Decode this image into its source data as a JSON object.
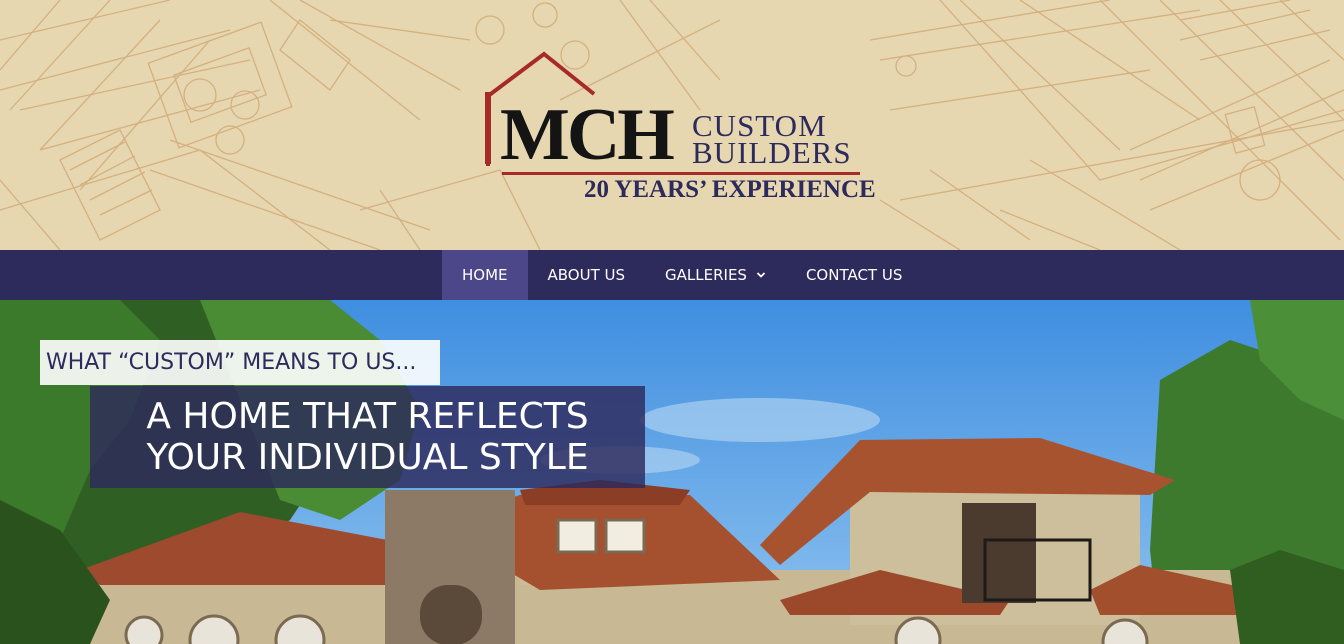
{
  "header": {
    "logo": {
      "mark": "MCH",
      "line1": "CUSTOM",
      "line2": "BUILDERS",
      "tagline": "20 YEARS’ EXPERIENCE"
    }
  },
  "nav": {
    "items": [
      {
        "label": "HOME",
        "active": true
      },
      {
        "label": "ABOUT US",
        "active": false
      },
      {
        "label": "GALLERIES",
        "active": false,
        "has_dropdown": true
      },
      {
        "label": "CONTACT US",
        "active": false
      }
    ]
  },
  "hero": {
    "kicker": "WHAT “CUSTOM” MEANS TO US...",
    "headline_line1": "A HOME THAT REFLECTS",
    "headline_line2": "YOUR INDIVIDUAL STYLE"
  },
  "colors": {
    "nav_bg": "#2d2a5c",
    "nav_active": "#4b4788",
    "header_bg": "#e6d7b0",
    "logo_red": "#a62a2a",
    "logo_navy": "#2d2a5c"
  },
  "icons": {
    "galleries_caret": "chevron-down-icon"
  }
}
